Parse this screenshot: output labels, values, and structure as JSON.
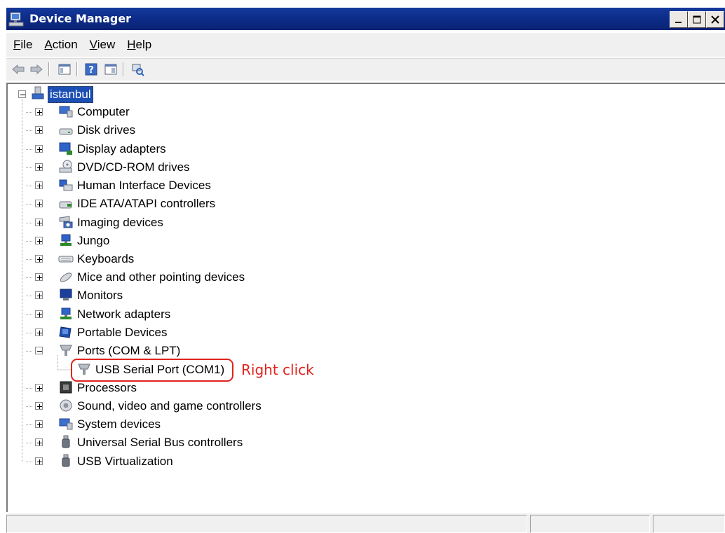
{
  "window": {
    "title": "Device Manager",
    "controls": [
      "minimize-icon",
      "maximize-icon",
      "close-icon"
    ]
  },
  "menu": [
    {
      "label": "File",
      "accel": "F",
      "rest": "ile"
    },
    {
      "label": "Action",
      "accel": "A",
      "rest": "ction"
    },
    {
      "label": "View",
      "accel": "V",
      "rest": "iew"
    },
    {
      "label": "Help",
      "accel": "H",
      "rest": "elp"
    }
  ],
  "toolbar": [
    "back-arrow-icon",
    "forward-arrow-icon",
    "show-hide-console-tree-icon",
    "help-icon",
    "properties-icon",
    "scan-hardware-changes-icon"
  ],
  "tree": {
    "root": {
      "label": "istanbul",
      "icon": "computer-icon",
      "expanded": true,
      "selected": true
    },
    "categories": [
      {
        "label": "Computer",
        "icon": "computer-icon",
        "expanded": false
      },
      {
        "label": "Disk drives",
        "icon": "disk-drive-icon",
        "expanded": false
      },
      {
        "label": "Display adapters",
        "icon": "display-adapter-icon",
        "expanded": false
      },
      {
        "label": "DVD/CD-ROM drives",
        "icon": "dvd-drive-icon",
        "expanded": false
      },
      {
        "label": "Human Interface Devices",
        "icon": "hid-icon",
        "expanded": false
      },
      {
        "label": "IDE ATA/ATAPI controllers",
        "icon": "ide-controller-icon",
        "expanded": false
      },
      {
        "label": "Imaging devices",
        "icon": "camera-icon",
        "expanded": false
      },
      {
        "label": "Jungo",
        "icon": "network-device-icon",
        "expanded": false
      },
      {
        "label": "Keyboards",
        "icon": "keyboard-icon",
        "expanded": false
      },
      {
        "label": "Mice and other pointing devices",
        "icon": "mouse-icon",
        "expanded": false
      },
      {
        "label": "Monitors",
        "icon": "monitor-icon",
        "expanded": false
      },
      {
        "label": "Network adapters",
        "icon": "network-adapter-icon",
        "expanded": false
      },
      {
        "label": "Portable Devices",
        "icon": "portable-device-icon",
        "expanded": false
      },
      {
        "label": "Ports (COM & LPT)",
        "icon": "port-icon",
        "expanded": true,
        "children": [
          {
            "label": "USB Serial Port (COM1)",
            "icon": "port-icon"
          }
        ]
      },
      {
        "label": "Processors",
        "icon": "processor-icon",
        "expanded": false
      },
      {
        "label": "Sound, video and game controllers",
        "icon": "speaker-icon",
        "expanded": false
      },
      {
        "label": "System devices",
        "icon": "computer-icon",
        "expanded": false
      },
      {
        "label": "Universal Serial Bus controllers",
        "icon": "usb-plug-icon",
        "expanded": false
      },
      {
        "label": "USB Virtualization",
        "icon": "usb-plug-icon",
        "expanded": false
      }
    ]
  },
  "annotation": {
    "text": "Right click",
    "color": "#e0231d"
  },
  "colors": {
    "titlebar": "#0c2a86",
    "selection": "#1c4fb4",
    "annotation": "#e0231d"
  }
}
